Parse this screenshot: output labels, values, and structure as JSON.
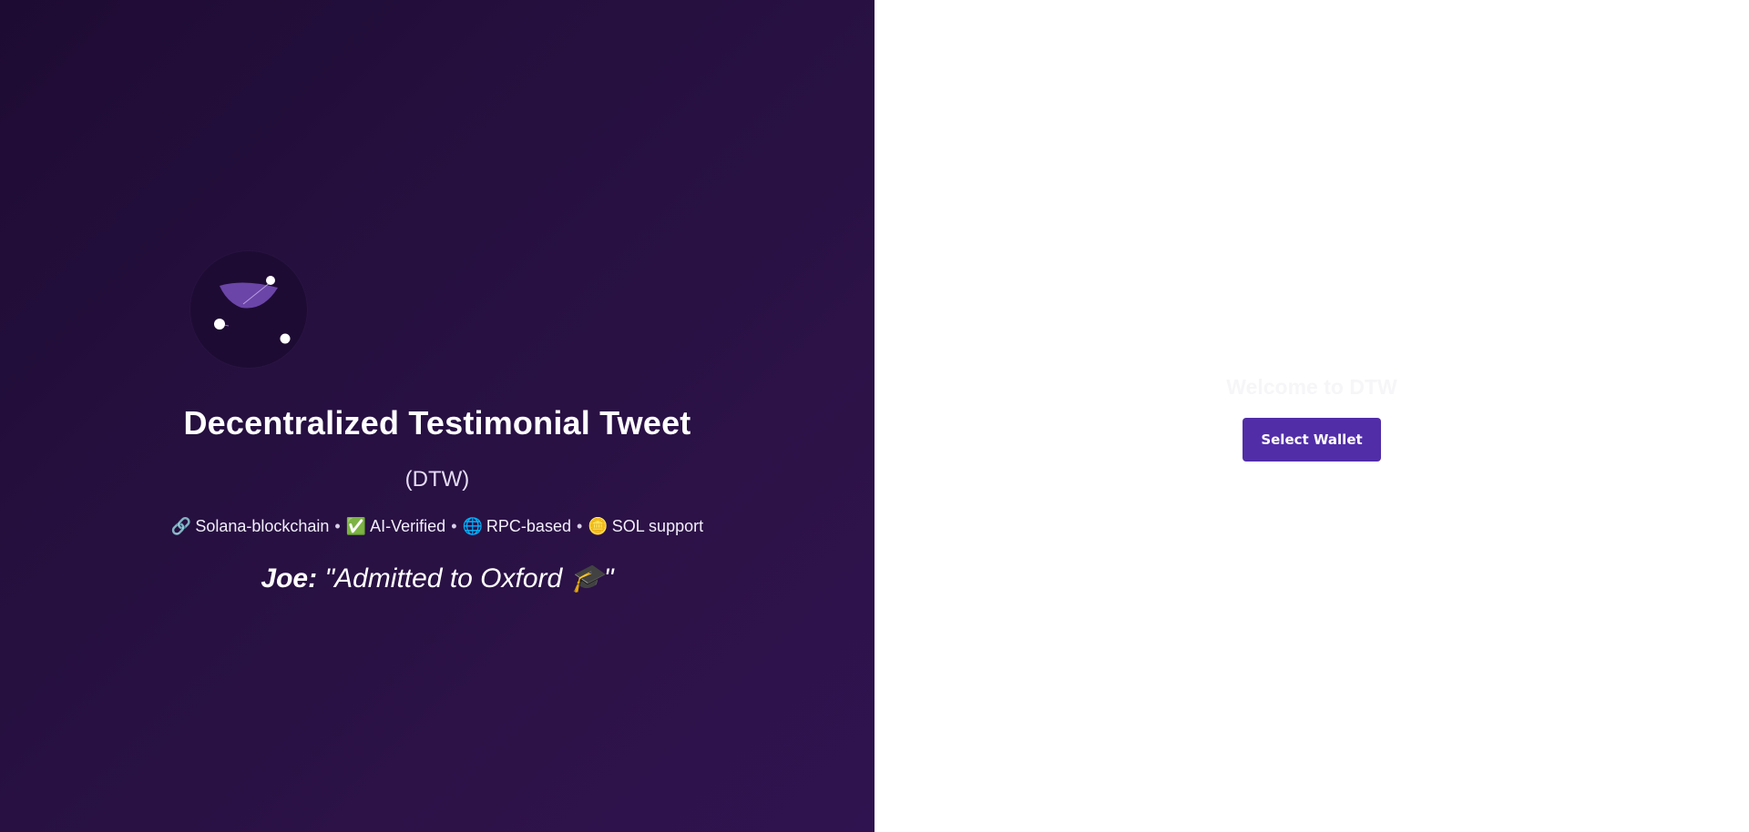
{
  "hero": {
    "title": "Decentralized Testimonial Tweet",
    "subtitle": "(DTW)",
    "features": [
      {
        "icon": "🔗",
        "label": "Solana-blockchain"
      },
      {
        "icon": "✅",
        "label": "AI-Verified"
      },
      {
        "icon": "🌐",
        "label": "RPC-based"
      },
      {
        "icon": "🪙",
        "label": "SOL support"
      }
    ],
    "separator": "•",
    "testimonial": {
      "author": "Joe:",
      "open_quote": "\"Admitted to Oxford ",
      "emoji": "🎓",
      "close_quote": "\""
    }
  },
  "panel": {
    "welcome": "Welcome to DTW",
    "select_wallet_label": "Select Wallet"
  },
  "colors": {
    "hero_bg": "#261040",
    "accent": "#512da8",
    "logo_leaf": "#6b45a8"
  }
}
